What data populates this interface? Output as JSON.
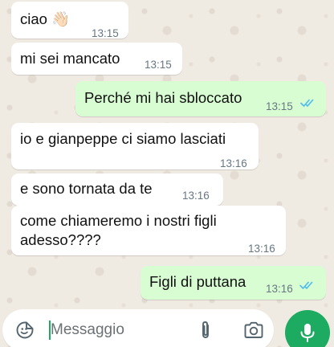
{
  "messages": [
    {
      "text": "ciao 👋🏻",
      "time": "13:15",
      "direction": "in"
    },
    {
      "text": "mi sei mancato",
      "time": "13:15",
      "direction": "in"
    },
    {
      "text": "Perché mi hai sbloccato",
      "time": "13:15",
      "direction": "out",
      "status": "read"
    },
    {
      "text": "io e gianpeppe ci siamo lasciati",
      "time": "13:16",
      "direction": "in"
    },
    {
      "text": "e sono tornata da te",
      "time": "13:16",
      "direction": "in"
    },
    {
      "line1": "come chiameremo i nostri figli",
      "line2": "adesso????",
      "time": "13:16",
      "direction": "in"
    },
    {
      "text": "Figli di puttana",
      "time": "13:16",
      "direction": "out",
      "status": "read"
    }
  ],
  "composer": {
    "placeholder": "Messaggio",
    "emoji_icon": "sticker-emoji-icon",
    "attach_icon": "paperclip-icon",
    "camera_icon": "camera-icon",
    "mic_icon": "microphone-icon"
  },
  "colors": {
    "incoming": "#ffffff",
    "outgoing": "#d9fdd3",
    "accent": "#1daa61",
    "read_ticks": "#53bdeb"
  }
}
